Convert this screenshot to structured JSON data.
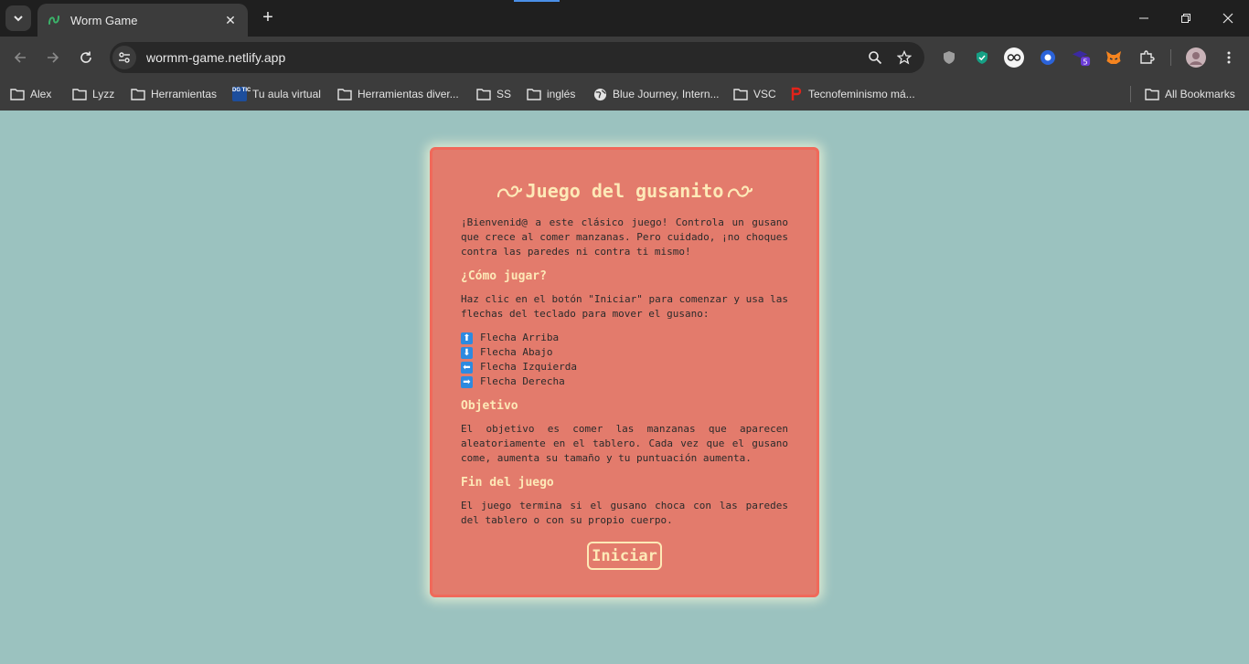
{
  "browser": {
    "tab_title": "Worm Game",
    "url": "wormm-game.netlify.app",
    "extension_badge": "5"
  },
  "bookmarks": [
    {
      "label": "Alex",
      "icon": "folder-icon"
    },
    {
      "label": "Lyzz",
      "icon": "folder-icon"
    },
    {
      "label": "Herramientas",
      "icon": "folder-icon"
    },
    {
      "label": "Tu aula virtual",
      "icon": "dgtic-icon"
    },
    {
      "label": "Herramientas diver...",
      "icon": "folder-icon"
    },
    {
      "label": "SS",
      "icon": "folder-icon"
    },
    {
      "label": "inglés",
      "icon": "folder-icon"
    },
    {
      "label": "Blue Journey, Intern...",
      "icon": "globe-icon"
    },
    {
      "label": "VSC",
      "icon": "folder-icon"
    },
    {
      "label": "Tecnofeminismo má...",
      "icon": "p-logo-icon"
    }
  ],
  "all_bookmarks": "All Bookmarks",
  "dgtic_logo": "DG TIC",
  "game": {
    "title": "Juego del gusanito",
    "intro": "¡Bienvenid@ a este clásico juego! Controla un gusano que crece al comer manzanas. Pero cuidado, ¡no choques contra las paredes ni contra ti mismo!",
    "how_heading": "¿Cómo jugar?",
    "how_text": "Haz clic en el botón \"Iniciar\" para comenzar y usa las flechas del teclado para mover el gusano:",
    "keys": [
      {
        "symbol": "⬆",
        "label": "Flecha Arriba"
      },
      {
        "symbol": "⬇",
        "label": "Flecha Abajo"
      },
      {
        "symbol": "⬅",
        "label": "Flecha Izquierda"
      },
      {
        "symbol": "➡",
        "label": "Flecha Derecha"
      }
    ],
    "goal_heading": "Objetivo",
    "goal_text": "El objetivo es comer las manzanas que aparecen aleatoriamente en el tablero. Cada vez que el gusano come, aumenta su tamaño y tu puntuación aumenta.",
    "end_heading": "Fin del juego",
    "end_text": "El juego termina si el gusano choca con las paredes del tablero o con su propio cuerpo.",
    "start_label": "Iniciar"
  },
  "colors": {
    "page_bg": "#9bc2bf",
    "card_bg": "#e37b6c",
    "card_border": "#f0695a",
    "heading": "#fde9b7",
    "key_icon": "#2d8ae0"
  }
}
